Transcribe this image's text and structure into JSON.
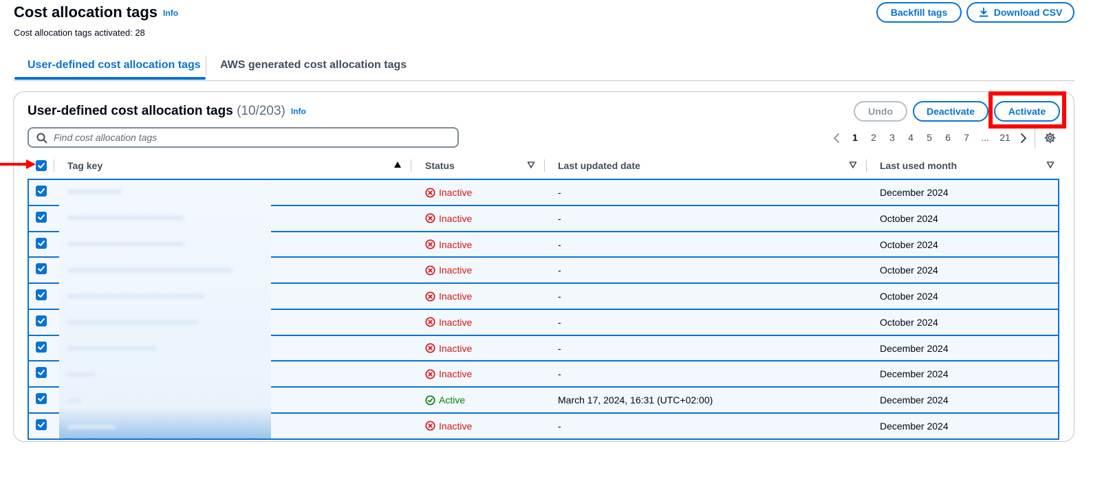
{
  "header": {
    "title": "Cost allocation tags",
    "info": "Info",
    "subtitle": "Cost allocation tags activated: 28",
    "backfill_label": "Backfill tags",
    "download_label": "Download CSV"
  },
  "tabs": [
    {
      "label": "User-defined cost allocation tags",
      "active": true
    },
    {
      "label": "AWS generated cost allocation tags",
      "active": false
    }
  ],
  "panel": {
    "title": "User-defined cost allocation tags",
    "count": "(10/203)",
    "info": "Info",
    "undo_label": "Undo",
    "deactivate_label": "Deactivate",
    "activate_label": "Activate",
    "search_placeholder": "Find cost allocation tags"
  },
  "pagination": {
    "pages": [
      "1",
      "2",
      "3",
      "4",
      "5",
      "6",
      "7",
      "...",
      "21"
    ],
    "current": "1"
  },
  "columns": [
    "Tag key",
    "Status",
    "Last updated date",
    "Last used month"
  ],
  "rows": [
    {
      "status": "Inactive",
      "updated": "-",
      "month": "December 2024"
    },
    {
      "status": "Inactive",
      "updated": "-",
      "month": "October 2024"
    },
    {
      "status": "Inactive",
      "updated": "-",
      "month": "October 2024"
    },
    {
      "status": "Inactive",
      "updated": "-",
      "month": "October 2024"
    },
    {
      "status": "Inactive",
      "updated": "-",
      "month": "October 2024"
    },
    {
      "status": "Inactive",
      "updated": "-",
      "month": "October 2024"
    },
    {
      "status": "Inactive",
      "updated": "-",
      "month": "December 2024"
    },
    {
      "status": "Inactive",
      "updated": "-",
      "month": "December 2024"
    },
    {
      "status": "Active",
      "updated": "March 17, 2024, 16:31 (UTC+02:00)",
      "month": "December 2024"
    },
    {
      "status": "Inactive",
      "updated": "-",
      "month": "December 2024"
    }
  ],
  "colors": {
    "primary": "#0972d3",
    "inactive": "#d91515",
    "active": "#037f0c",
    "row_selected_bg": "#f2f8fd",
    "annotation": "#ff0000"
  },
  "icons": {
    "download": "download-icon",
    "search": "search-icon",
    "settings": "gear-icon",
    "inactive": "x-circle-icon",
    "active": "check-circle-icon"
  }
}
